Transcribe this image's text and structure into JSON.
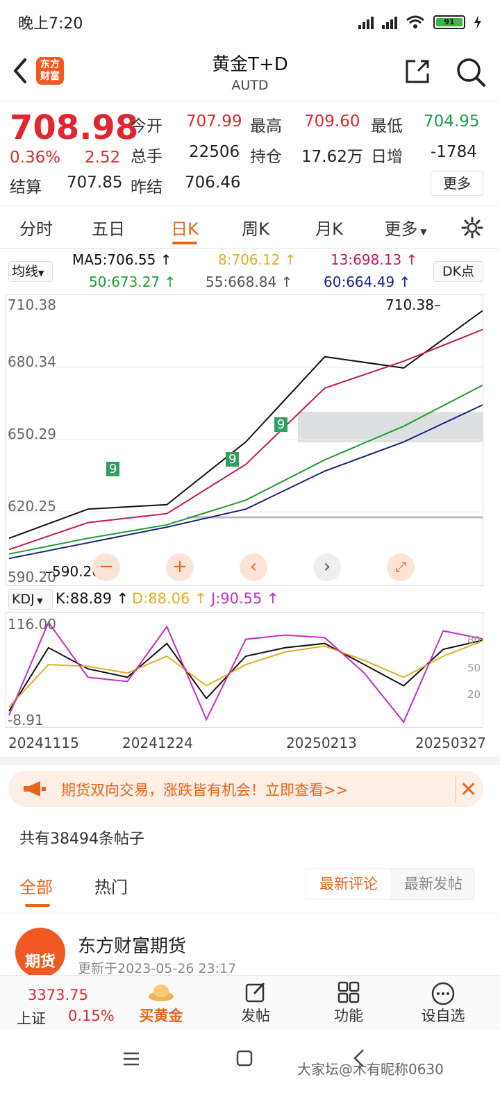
{
  "status": {
    "time": "晚上7:20",
    "battery": "91"
  },
  "header": {
    "logo_text": "东方财富",
    "title": "黄金T+D",
    "code": "AUTD"
  },
  "quote": {
    "price": "708.98",
    "change_pct": "0.36%",
    "change": "2.52",
    "open_label": "今开",
    "open": "707.99",
    "high_label": "最高",
    "high": "709.60",
    "low_label": "最低",
    "low": "704.95",
    "volume_label": "总手",
    "volume": "22506",
    "oi_label": "持仓",
    "oi": "17.62万",
    "daily_inc_label": "日增",
    "daily_inc": "-1784",
    "settle_label": "结算",
    "settle": "707.85",
    "prev_settle_label": "昨结",
    "prev_settle": "706.46",
    "more": "更多"
  },
  "tabs": [
    "分时",
    "五日",
    "日K",
    "周K",
    "月K",
    "更多"
  ],
  "ma": {
    "select": "均线",
    "ma5": "MA5:706.55 ↑",
    "ma8": "8:706.12 ↑",
    "ma13": "13:698.13 ↑",
    "ma50": "50:673.27 ↑",
    "ma55": "55:668.84 ↑",
    "ma60": "60:664.49 ↑",
    "dk": "DK点"
  },
  "chart_data": [
    {
      "type": "line",
      "title": "",
      "y_ticks": [
        "710.38",
        "680.34",
        "650.29",
        "620.25",
        "590.20"
      ],
      "ylim": [
        590.2,
        710.38
      ],
      "annotations": [
        "710.38",
        "590.20",
        "9"
      ],
      "x": [
        "20241115",
        "20241224",
        "20250213",
        "20250327"
      ],
      "series": [
        {
          "name": "MA5",
          "values": [
            605,
            618,
            620,
            648,
            686,
            681,
            706.55
          ],
          "color": "#111111"
        },
        {
          "name": "MA13",
          "values": [
            600,
            612,
            616,
            638,
            672,
            684,
            698.13
          ],
          "color": "#c2185b"
        },
        {
          "name": "MA50",
          "values": [
            598,
            605,
            611,
            622,
            640,
            655,
            673.27
          ],
          "color": "#1f9d2e"
        },
        {
          "name": "MA60",
          "values": [
            596,
            603,
            610,
            618,
            635,
            648,
            664.49
          ],
          "color": "#1a237e"
        }
      ]
    },
    {
      "type": "line",
      "title": "KDJ",
      "y_ticks": [
        "116.00",
        "80",
        "50",
        "20",
        "-8.91"
      ],
      "ylim": [
        -8.91,
        116.0
      ],
      "series": [
        {
          "name": "K",
          "values": [
            5,
            80,
            55,
            45,
            85,
            20,
            70,
            80,
            85,
            60,
            35,
            78,
            88.89
          ],
          "color": "#111111"
        },
        {
          "name": "D",
          "values": [
            10,
            60,
            58,
            50,
            70,
            35,
            60,
            75,
            82,
            65,
            45,
            70,
            88.06
          ],
          "color": "#e0b020"
        },
        {
          "name": "J",
          "values": [
            0,
            110,
            45,
            40,
            105,
            -5,
            90,
            95,
            92,
            50,
            -8,
            100,
            90.55
          ],
          "color": "#c030c0"
        }
      ]
    }
  ],
  "kdj_labels": {
    "select": "KDJ",
    "k": "K:88.89 ↑",
    "d": "D:88.06 ↑",
    "j": "J:90.55 ↑"
  },
  "promo": "期货双向交易，涨跌皆有机会！立即查看>>",
  "posts": {
    "count_text": "共有38494条帖子",
    "tab_all": "全部",
    "tab_hot": "热门",
    "sort_latest_comment": "最新评论",
    "sort_latest_post": "最新发帖",
    "first": {
      "avatar_text": "期货",
      "name": "东方财富期货",
      "date": "更新于2023-05-26 23:17"
    }
  },
  "bottom_nav": {
    "index_value": "3373.75",
    "index_name": "上证",
    "index_pct": "0.15%",
    "buy_gold": "买黄金",
    "post": "发帖",
    "func": "功能",
    "watch": "设自选"
  },
  "watermark": "大家坛@木有昵称0630"
}
